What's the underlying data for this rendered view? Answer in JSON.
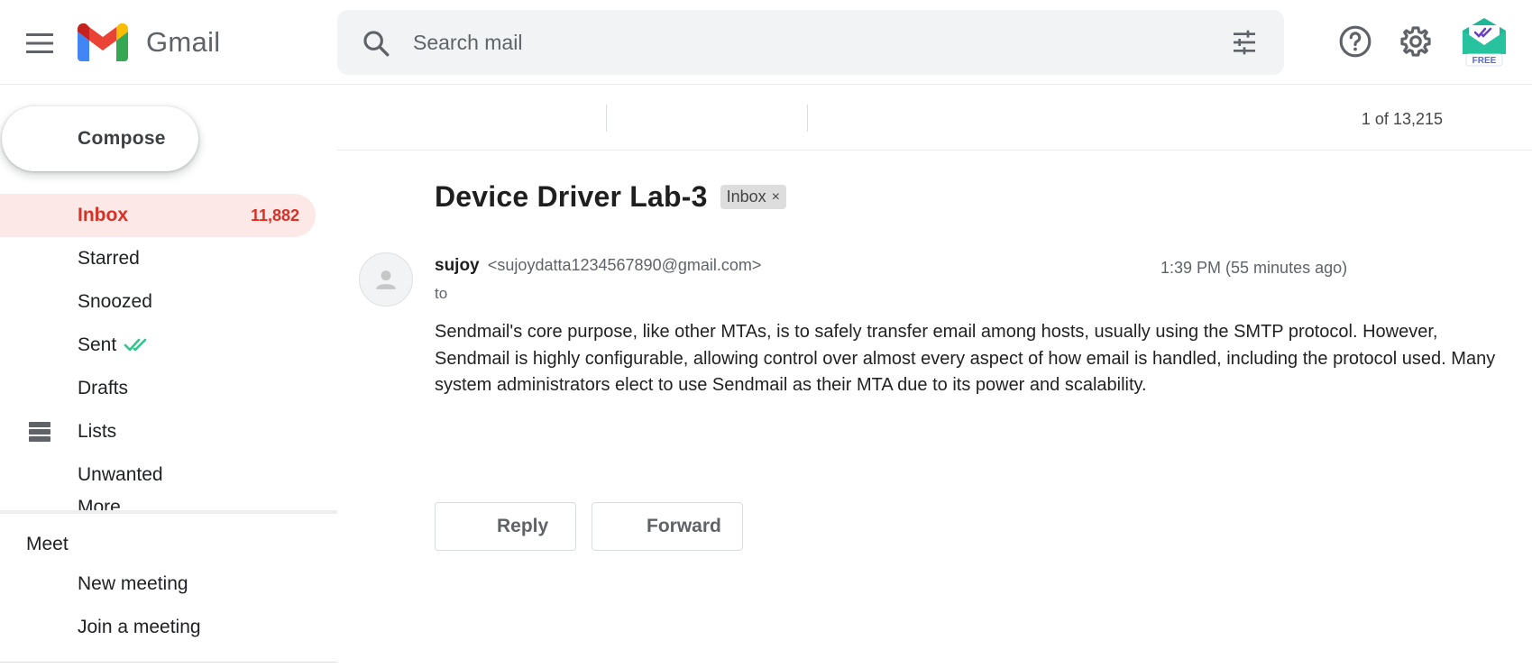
{
  "app": {
    "name": "Gmail",
    "colors": {
      "accent": "#d93025",
      "active_bg": "#fce8e6",
      "sent_check": "#34c38f"
    }
  },
  "header": {
    "logo_text": "Gmail",
    "search": {
      "placeholder": "Search mail",
      "value": ""
    },
    "addon_badge": "FREE",
    "icons": [
      "menu-icon",
      "gmail-logo-icon",
      "search-icon",
      "tune-icon",
      "help-icon",
      "gear-icon",
      "addon-mail-check-icon"
    ]
  },
  "sidebar": {
    "compose_label": "Compose",
    "items": [
      {
        "label": "Inbox",
        "count": "11,882",
        "active": true
      },
      {
        "label": "Starred"
      },
      {
        "label": "Snoozed"
      },
      {
        "label": "Sent"
      },
      {
        "label": "Drafts"
      },
      {
        "label": "Lists"
      },
      {
        "label": "Unwanted"
      },
      {
        "label": "More"
      }
    ],
    "meet": {
      "title": "Meet",
      "items": [
        {
          "label": "New meeting"
        },
        {
          "label": "Join a meeting"
        }
      ]
    }
  },
  "toolbar": {
    "pagination": "1 of 13,215"
  },
  "message": {
    "subject": "Device Driver Lab-3",
    "label_chip": "Inbox",
    "label_chip_close": "×",
    "sender_name": "sujoy",
    "sender_email": "<sujoydatta1234567890@gmail.com>",
    "recipient_prefix": "to",
    "timestamp": "1:39 PM (55 minutes ago)",
    "body": "Sendmail's core purpose, like other MTAs, is to safely transfer email among hosts, usually using the SMTP protocol. However, Sendmail is highly configurable, allowing control over almost every aspect of how email is handled, including the protocol used. Many system administrators elect to use Sendmail as their MTA due to its power and scalability.",
    "reply_label": "Reply",
    "forward_label": "Forward"
  }
}
